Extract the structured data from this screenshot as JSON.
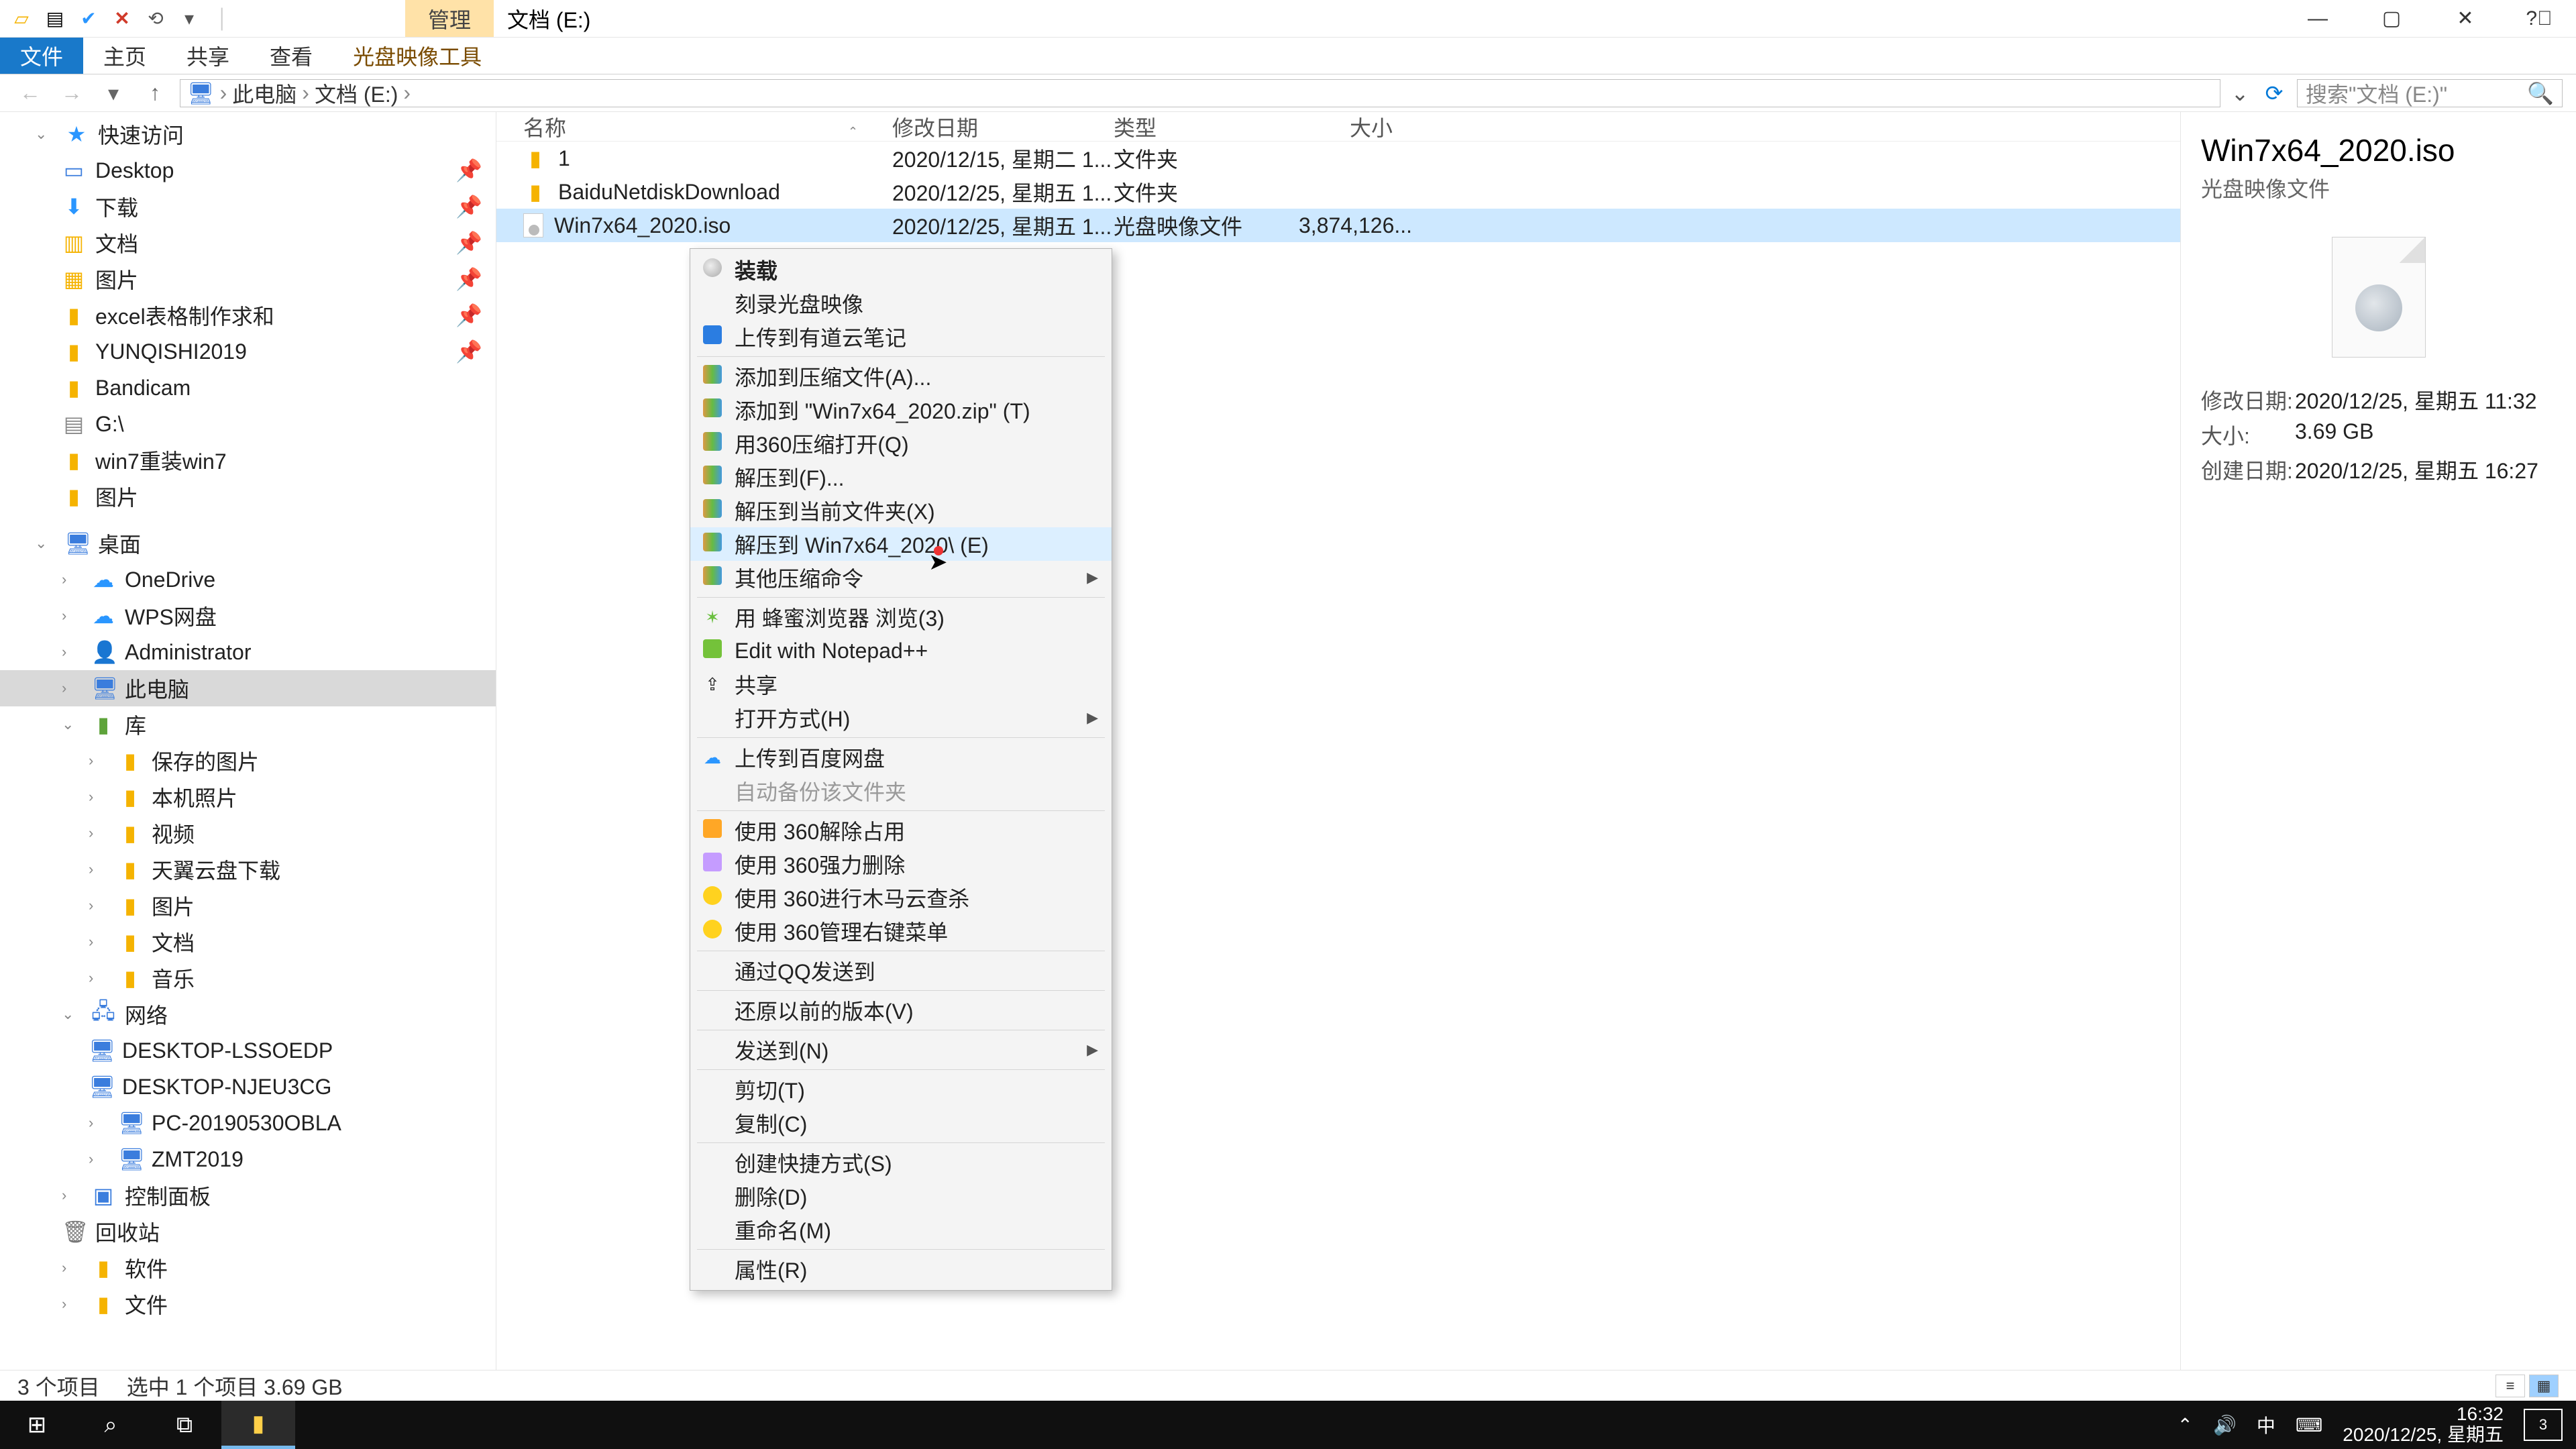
{
  "title_contextual_tab": "管理",
  "title_window": "文档 (E:)",
  "ribbon": {
    "file": "文件",
    "home": "主页",
    "share": "共享",
    "view": "查看",
    "tool": "光盘映像工具"
  },
  "breadcrumb": {
    "root": "此电脑",
    "seg1": "文档 (E:)"
  },
  "search_placeholder": "搜索\"文档 (E:)\"",
  "columns": {
    "name": "名称",
    "date": "修改日期",
    "type": "类型",
    "size": "大小"
  },
  "rows": [
    {
      "name": "1",
      "date": "2020/12/15, 星期二 1...",
      "type": "文件夹",
      "size": ""
    },
    {
      "name": "BaiduNetdiskDownload",
      "date": "2020/12/25, 星期五 1...",
      "type": "文件夹",
      "size": ""
    },
    {
      "name": "Win7x64_2020.iso",
      "date": "2020/12/25, 星期五 1...",
      "type": "光盘映像文件",
      "size": "3,874,126..."
    }
  ],
  "tree": {
    "quick": "快速访问",
    "quick_items": [
      "Desktop",
      "下载",
      "文档",
      "图片",
      "excel表格制作求和",
      "YUNQISHI2019",
      "Bandicam",
      "G:\\",
      "win7重装win7",
      "图片"
    ],
    "desktop": "桌面",
    "desktop_items": [
      "OneDrive",
      "WPS网盘",
      "Administrator",
      "此电脑",
      "库"
    ],
    "lib_items": [
      "保存的图片",
      "本机照片",
      "视频",
      "天翼云盘下载",
      "图片",
      "文档",
      "音乐"
    ],
    "network": "网络",
    "network_items": [
      "DESKTOP-LSSOEDP",
      "DESKTOP-NJEU3CG",
      "PC-20190530OBLA",
      "ZMT2019"
    ],
    "control_panel": "控制面板",
    "recycle": "回收站",
    "software": "软件",
    "files": "文件"
  },
  "details": {
    "name": "Win7x64_2020.iso",
    "subtype": "光盘映像文件",
    "mdate_k": "修改日期:",
    "mdate_v": "2020/12/25, 星期五 11:32",
    "size_k": "大小:",
    "size_v": "3.69 GB",
    "cdate_k": "创建日期:",
    "cdate_v": "2020/12/25, 星期五 16:27"
  },
  "status": {
    "items": "3 个项目",
    "sel": "选中 1 个项目  3.69 GB"
  },
  "ctx": {
    "mount": "装载",
    "burn": "刻录光盘映像",
    "youdao": "上传到有道云笔记",
    "add_archive": "添加到压缩文件(A)...",
    "add_zip": "添加到 \"Win7x64_2020.zip\" (T)",
    "open_360zip": "用360压缩打开(Q)",
    "extract_to": "解压到(F)...",
    "extract_here": "解压到当前文件夹(X)",
    "extract_named": "解压到 Win7x64_2020\\ (E)",
    "other_zip": "其他压缩命令",
    "fengmi": "用 蜂蜜浏览器 浏览(3)",
    "npp": "Edit with Notepad++",
    "share": "共享",
    "open_with": "打开方式(H)",
    "baidu_upload": "上传到百度网盘",
    "auto_backup": "自动备份该文件夹",
    "unlock360": "使用 360解除占用",
    "forcedel360": "使用 360强力删除",
    "trojan360": "使用 360进行木马云查杀",
    "manage360": "使用 360管理右键菜单",
    "qq_send": "通过QQ发送到",
    "restore_prev": "还原以前的版本(V)",
    "send_to": "发送到(N)",
    "cut": "剪切(T)",
    "copy": "复制(C)",
    "shortcut": "创建快捷方式(S)",
    "delete": "删除(D)",
    "rename": "重命名(M)",
    "properties": "属性(R)"
  },
  "taskbar": {
    "ime": "中",
    "time": "16:32",
    "date": "2020/12/25, 星期五",
    "badge": "3"
  }
}
